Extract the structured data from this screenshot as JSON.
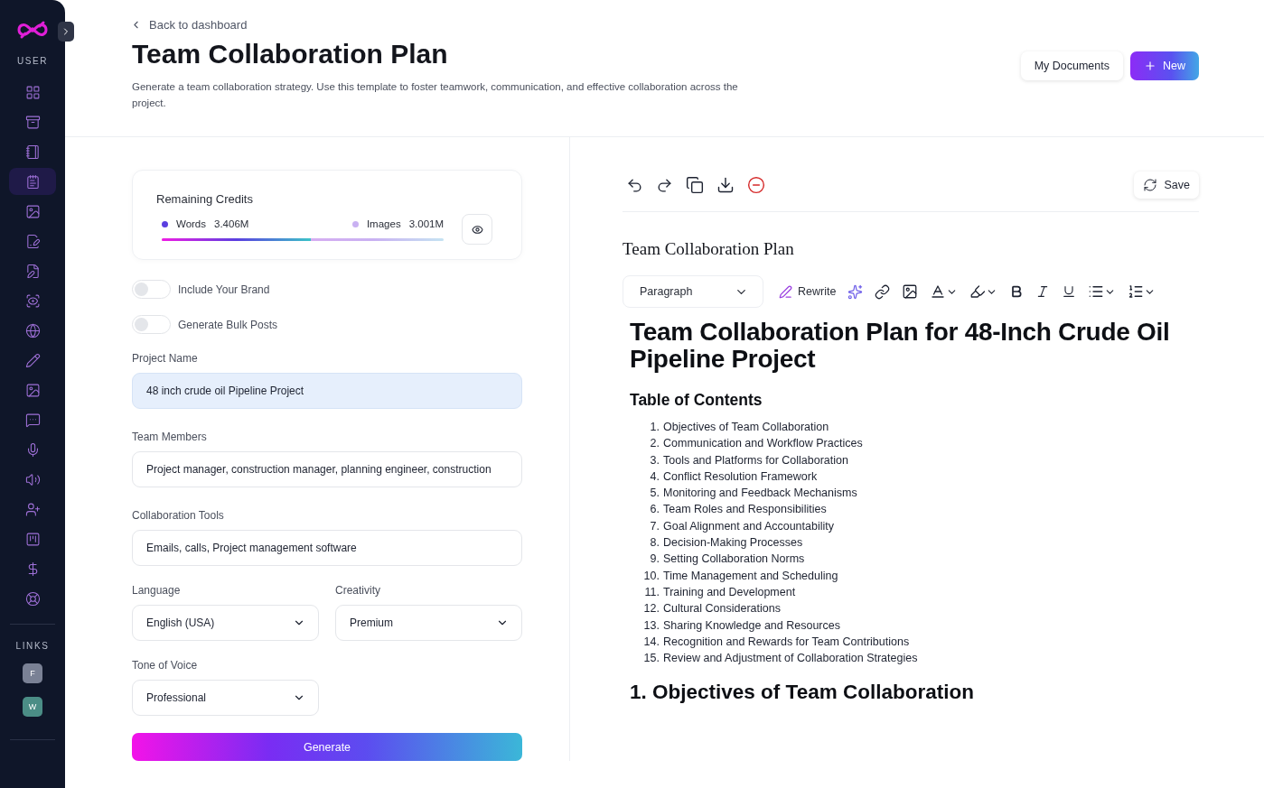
{
  "sidebar": {
    "sections": [
      {
        "label": "USER",
        "items": [
          {
            "selected": false
          },
          {
            "selected": false
          },
          {
            "selected": false
          },
          {
            "selected": true
          },
          {
            "selected": false
          },
          {
            "selected": false
          },
          {
            "selected": false
          },
          {
            "selected": false
          },
          {
            "selected": false
          },
          {
            "selected": false
          },
          {
            "selected": false
          },
          {
            "selected": false
          },
          {
            "selected": false
          },
          {
            "selected": false
          },
          {
            "selected": false
          },
          {
            "selected": false
          },
          {
            "selected": false
          },
          {
            "selected": false
          }
        ]
      },
      {
        "label": "LINKS",
        "items": [
          {
            "letter": "F",
            "color": "#7a8195"
          },
          {
            "letter": "W",
            "color": "#4b8d86"
          }
        ]
      }
    ]
  },
  "header": {
    "back_link": "Back to dashboard",
    "title": "Team Collaboration Plan",
    "description": "Generate a team collaboration strategy. Use this template to foster teamwork, communication, and effective collaboration across the project.",
    "buttons": [
      {
        "label": "My Documents",
        "kind": "secondary"
      },
      {
        "label": "New",
        "kind": "primary"
      }
    ]
  },
  "credits": {
    "title": "Remaining Credits",
    "items": [
      {
        "label": "Words",
        "value": "3.406M",
        "color": "#5b3fe0",
        "level": 0.53
      },
      {
        "label": "Images",
        "value": "3.001M",
        "color": "#c9b1f2"
      }
    ]
  },
  "toggles": [
    {
      "label": "Include Your Brand",
      "on": false
    },
    {
      "label": "Generate Bulk Posts",
      "on": false
    }
  ],
  "fields": [
    {
      "label": "Project Name",
      "value": "48 inch crude oil Pipeline Project",
      "focused": true
    },
    {
      "label": "Team Members",
      "value": "Project manager, construction manager, planning engineer, construction",
      "focused": false
    },
    {
      "label": "Collaboration Tools",
      "value": "Emails, calls, Project management software",
      "focused": false
    }
  ],
  "selects": [
    {
      "label": "Language",
      "value": "English (USA)"
    },
    {
      "label": "Creativity",
      "value": "Premium"
    },
    {
      "label": "Tone of Voice",
      "value": "Professional"
    }
  ],
  "generate_button": "Generate",
  "editor": {
    "save_button": "Save",
    "document_title": "Team Collaboration Plan",
    "block_type": "Paragraph",
    "rewrite_button": "Rewrite",
    "heading": "Team Collaboration Plan for 48-Inch Crude Oil Pipeline Project",
    "toc_heading": "Table of Contents",
    "toc": [
      {
        "number": "1.",
        "text": "Objectives of Team Collaboration"
      },
      {
        "number": "2.",
        "text": "Communication and Workflow Practices"
      },
      {
        "number": "3.",
        "text": "Tools and Platforms for Collaboration"
      },
      {
        "number": "4.",
        "text": "Conflict Resolution Framework"
      },
      {
        "number": "5.",
        "text": "Monitoring and Feedback Mechanisms"
      },
      {
        "number": "6.",
        "text": "Team Roles and Responsibilities"
      },
      {
        "number": "7.",
        "text": "Goal Alignment and Accountability"
      },
      {
        "number": "8.",
        "text": "Decision-Making Processes"
      },
      {
        "number": "9.",
        "text": "Setting Collaboration Norms"
      },
      {
        "number": "10.",
        "text": "Time Management and Scheduling"
      },
      {
        "number": "11.",
        "text": "Training and Development"
      },
      {
        "number": "12.",
        "text": "Cultural Considerations"
      },
      {
        "number": "13.",
        "text": "Sharing Knowledge and Resources"
      },
      {
        "number": "14.",
        "text": "Recognition and Rewards for Team Contributions"
      },
      {
        "number": "15.",
        "text": "Review and Adjustment of Collaboration Strategies"
      }
    ],
    "section_heading": "1. Objectives of Team Collaboration"
  }
}
